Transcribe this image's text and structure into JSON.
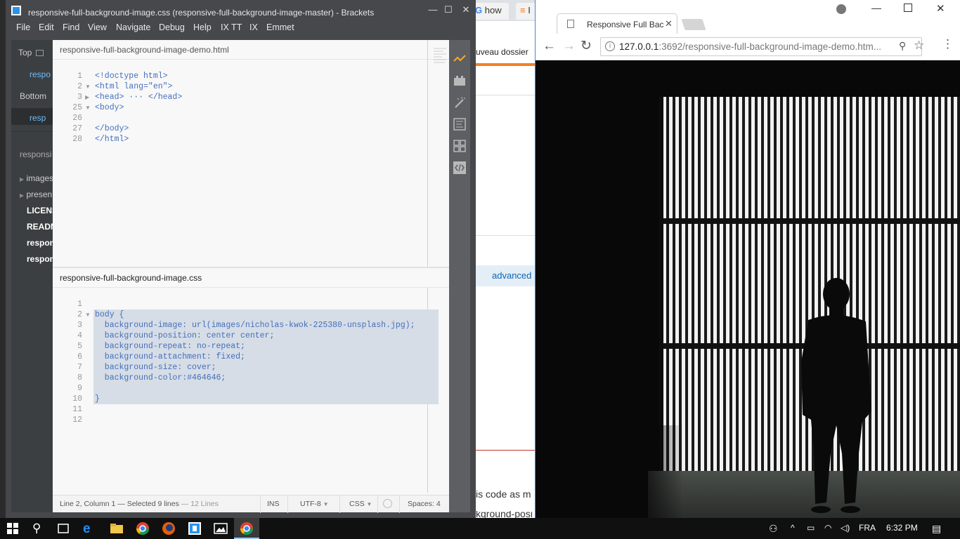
{
  "background_browser": {
    "tabs": [
      "how",
      "I"
    ],
    "fragments": {
      "folder": "uveau dossier",
      "link": "advanced",
      "text1": "is code as m",
      "text2": "kground-posi"
    }
  },
  "brackets": {
    "window_title": "responsive-full-background-image.css (responsive-full-background-image-master) - Brackets",
    "menu": [
      "File",
      "Edit",
      "Find",
      "View",
      "Navigate",
      "Debug",
      "Help",
      "IX TT",
      "IX",
      "Emmet"
    ],
    "window_controls": {
      "minimize": "—",
      "maximize": "☐",
      "close": "✕"
    },
    "sidebar": {
      "top_label": "Top",
      "top_item": "respo",
      "bottom_label": "Bottom",
      "bottom_item": "resp",
      "project": "responsi",
      "tree": [
        "images",
        "presen",
        "LICENS",
        "READM",
        "respon",
        "respon"
      ]
    },
    "top_pane": {
      "filename": "responsive-full-background-image-demo.html",
      "lines": [
        {
          "num": "1",
          "fold": "",
          "code": "<!doctype html>"
        },
        {
          "num": "2",
          "fold": "▼",
          "code": "<html lang=\"en\">"
        },
        {
          "num": "3",
          "fold": "▶",
          "code": "<head> ··· </head>"
        },
        {
          "num": "25",
          "fold": "▼",
          "code": "<body>"
        },
        {
          "num": "26",
          "fold": "",
          "code": ""
        },
        {
          "num": "27",
          "fold": "",
          "code": "</body>"
        },
        {
          "num": "28",
          "fold": "",
          "code": "</html>"
        }
      ]
    },
    "bottom_pane": {
      "filename": "responsive-full-background-image.css",
      "lines": [
        {
          "num": "1",
          "code": ""
        },
        {
          "num": "2",
          "code": "body {"
        },
        {
          "num": "3",
          "code": "  background-image: url(images/nicholas-kwok-225380-unsplash.jpg);"
        },
        {
          "num": "4",
          "code": "  background-position: center center;"
        },
        {
          "num": "5",
          "code": "  background-repeat: no-repeat;"
        },
        {
          "num": "6",
          "code": "  background-attachment: fixed;"
        },
        {
          "num": "7",
          "code": "  background-size: cover;"
        },
        {
          "num": "8",
          "code": "  background-color:#464646;"
        },
        {
          "num": "9",
          "code": ""
        },
        {
          "num": "10",
          "code": "}"
        },
        {
          "num": "11",
          "code": ""
        },
        {
          "num": "12",
          "code": ""
        }
      ]
    },
    "status": {
      "cursor": "Line 2, Column 1 — Selected 9 lines",
      "lines_count": "— 12 Lines",
      "mode": "INS",
      "encoding": "UTF-8",
      "language": "CSS",
      "spaces": "Spaces: 4"
    }
  },
  "chrome": {
    "tab_title": "Responsive Full Backgrou",
    "url_host": "127.0.0.1",
    "url_rest": ":3692/responsive-full-background-image-demo.htm..."
  },
  "taskbar": {
    "language": "FRA",
    "time": "6:32 PM"
  },
  "colors": {
    "brackets_chrome": "#47484b",
    "editor_bg": "#f8f8f8",
    "selection": "#d6dde6",
    "tag_blue": "#446fbd",
    "value_orange": "#e88501",
    "photo_bg": "#080808"
  }
}
